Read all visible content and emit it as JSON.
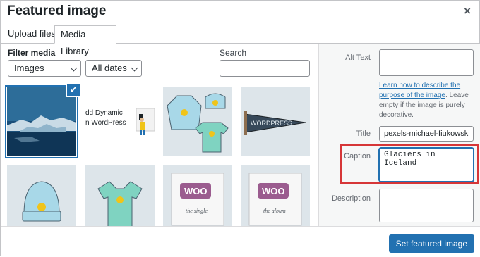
{
  "dialog": {
    "title": "Featured image",
    "close": "×"
  },
  "tabs": [
    {
      "label": "Upload files"
    },
    {
      "label": "Media Library"
    }
  ],
  "filters": {
    "label": "Filter media",
    "type": {
      "selected": "Images"
    },
    "date": {
      "selected": "All dates"
    },
    "search": {
      "label": "Search",
      "value": ""
    }
  },
  "media": {
    "items": [
      {
        "name": "Glaciers in Iceland",
        "selected": true
      },
      {
        "name": "WordPress blog post image",
        "text_lines": [
          "dd Dynamic",
          "n WordPress"
        ]
      },
      {
        "name": "Hoodies and beanie"
      },
      {
        "name": "WordPress pennant",
        "pennant_text": "WORDPRESS"
      },
      {
        "name": "Beanie"
      },
      {
        "name": "V-neck t-shirt"
      },
      {
        "name": "Woo single",
        "logo": "WOO",
        "caption": "the single"
      },
      {
        "name": "Woo album",
        "logo": "WOO",
        "caption": "the album"
      }
    ],
    "selected_check": "✔"
  },
  "details": {
    "alt_text": {
      "label": "Alt Text",
      "value": ""
    },
    "help": {
      "link": "Learn how to describe the purpose of the image",
      "text": ". Leave empty if the image is purely decorative."
    },
    "title": {
      "label": "Title",
      "value": "pexels-michael-fiukowski"
    },
    "caption": {
      "label": "Caption",
      "value": "Glaciers in Iceland"
    },
    "description": {
      "label": "Description",
      "value": ""
    }
  },
  "footer": {
    "button": "Set featured image"
  },
  "colors": {
    "accent": "#2271b1",
    "highlight": "#d63638"
  }
}
